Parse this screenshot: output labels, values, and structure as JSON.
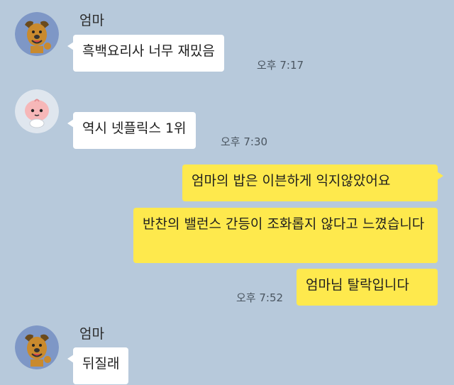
{
  "messages": [
    {
      "sender": "엄마",
      "avatar": "dog-character-icon",
      "text": "흑백요리사 너무 재밌음",
      "time": "오후 7:17"
    },
    {
      "sender": "",
      "avatar": "peach-character-icon",
      "text": "역시 넷플릭스 1위",
      "time": "오후 7:30"
    },
    {
      "sender": "me",
      "text": "엄마의 밥은 이븐하게 익지않았어요",
      "time": ""
    },
    {
      "sender": "me",
      "text": "반찬의 밸런스 간등이 조화롭지 않다고 느꼈습니다",
      "time": ""
    },
    {
      "sender": "me",
      "text": "엄마님 탈락입니다",
      "time": "오후 7:52"
    },
    {
      "sender": "엄마",
      "avatar": "dog-character-icon",
      "text": "뒤질래",
      "time": ""
    }
  ],
  "colors": {
    "background": "#b7c9db",
    "incoming_bubble": "#ffffff",
    "outgoing_bubble": "#fee94d"
  }
}
